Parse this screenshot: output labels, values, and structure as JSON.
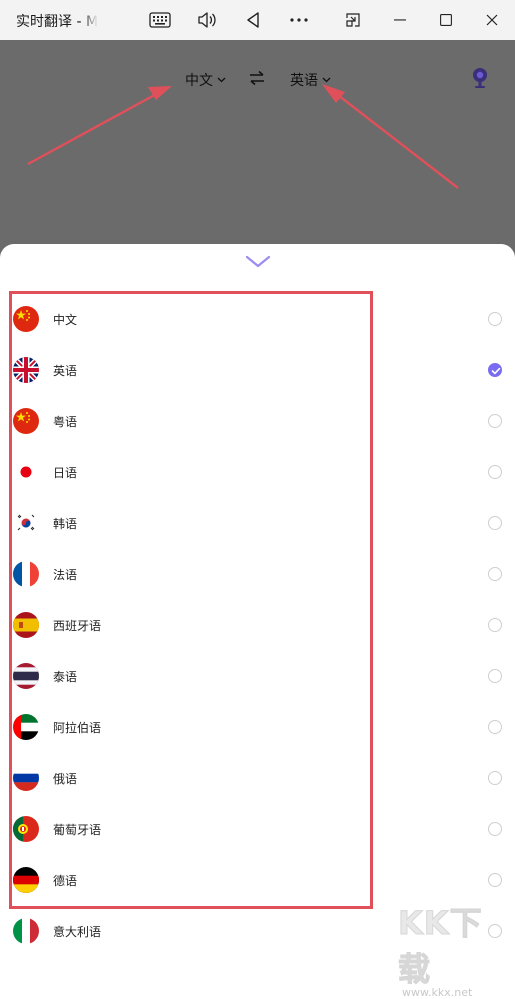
{
  "window": {
    "title": "实时翻译 - M",
    "controls": [
      "keyboard-icon",
      "speaker-icon",
      "back-triangle-icon",
      "more-icon",
      "snap-icon",
      "minimize-icon",
      "maximize-icon",
      "close-icon"
    ]
  },
  "header": {
    "source_language": "中文",
    "target_language": "英语",
    "swap_icon": "swap-arrows-icon",
    "avatar_icon": "user-avatar-icon",
    "colors": {
      "background": "#6b6b6b",
      "annotation": "#e0505a"
    }
  },
  "sheet": {
    "collapse_icon": "chevron-down-icon",
    "accent": "#7a6cf0",
    "languages": [
      {
        "label": "中文",
        "flag": "china",
        "selected": false
      },
      {
        "label": "英语",
        "flag": "uk",
        "selected": true
      },
      {
        "label": "粤语",
        "flag": "china",
        "selected": false
      },
      {
        "label": "日语",
        "flag": "japan",
        "selected": false
      },
      {
        "label": "韩语",
        "flag": "korea",
        "selected": false
      },
      {
        "label": "法语",
        "flag": "france",
        "selected": false
      },
      {
        "label": "西班牙语",
        "flag": "spain",
        "selected": false
      },
      {
        "label": "泰语",
        "flag": "thailand",
        "selected": false
      },
      {
        "label": "阿拉伯语",
        "flag": "uae",
        "selected": false
      },
      {
        "label": "俄语",
        "flag": "russia",
        "selected": false
      },
      {
        "label": "葡萄牙语",
        "flag": "portugal",
        "selected": false
      },
      {
        "label": "德语",
        "flag": "germany",
        "selected": false
      },
      {
        "label": "意大利语",
        "flag": "italy",
        "selected": false
      }
    ]
  },
  "watermark": {
    "main": "KK下载",
    "sub": "www.kkx.net"
  }
}
